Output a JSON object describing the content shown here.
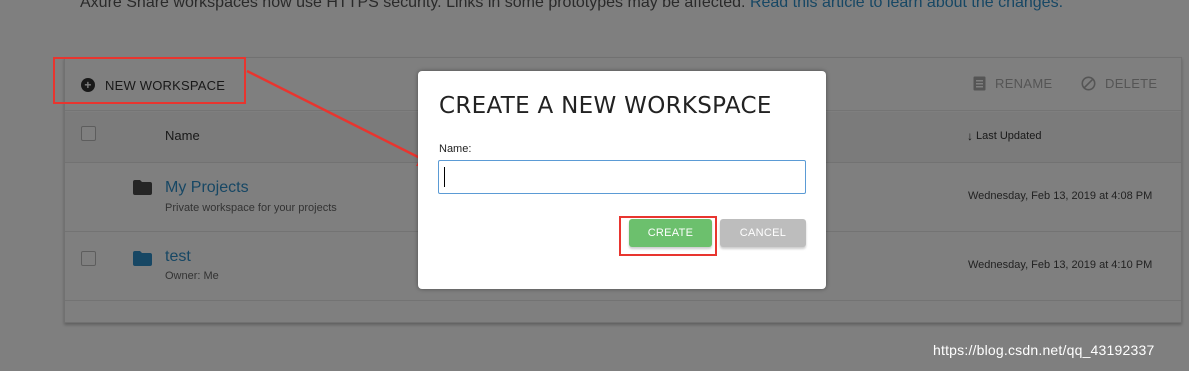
{
  "notice": {
    "text": "Axure Share workspaces now use HTTPS security. Links in some prototypes may be affected. ",
    "link": "Read this article to learn about the changes."
  },
  "toolbar": {
    "new_workspace_label": "NEW WORKSPACE",
    "rename_label": "RENAME",
    "delete_label": "DELETE"
  },
  "table": {
    "columns": {
      "name": "Name",
      "last_updated": "Last Updated"
    },
    "rows": [
      {
        "title": "My Projects",
        "subtitle": "Private workspace for your projects",
        "date": "Wednesday, Feb 13, 2019 at 4:08 PM",
        "folder_color": "#4a4a4a"
      },
      {
        "title": "test",
        "subtitle": "Owner: Me",
        "date": "Wednesday, Feb 13, 2019 at 4:10 PM",
        "folder_color": "#2f8fc9"
      }
    ]
  },
  "modal": {
    "title": "CREATE A NEW WORKSPACE",
    "name_label": "Name:",
    "name_value": "",
    "create_label": "CREATE",
    "cancel_label": "CANCEL"
  },
  "watermark": "https://blog.csdn.net/qq_43192337",
  "colors": {
    "link": "#2f8fc9",
    "create_button": "#6cc06d",
    "cancel_button": "#bdbdbd",
    "annotation_red": "#e8352f"
  }
}
